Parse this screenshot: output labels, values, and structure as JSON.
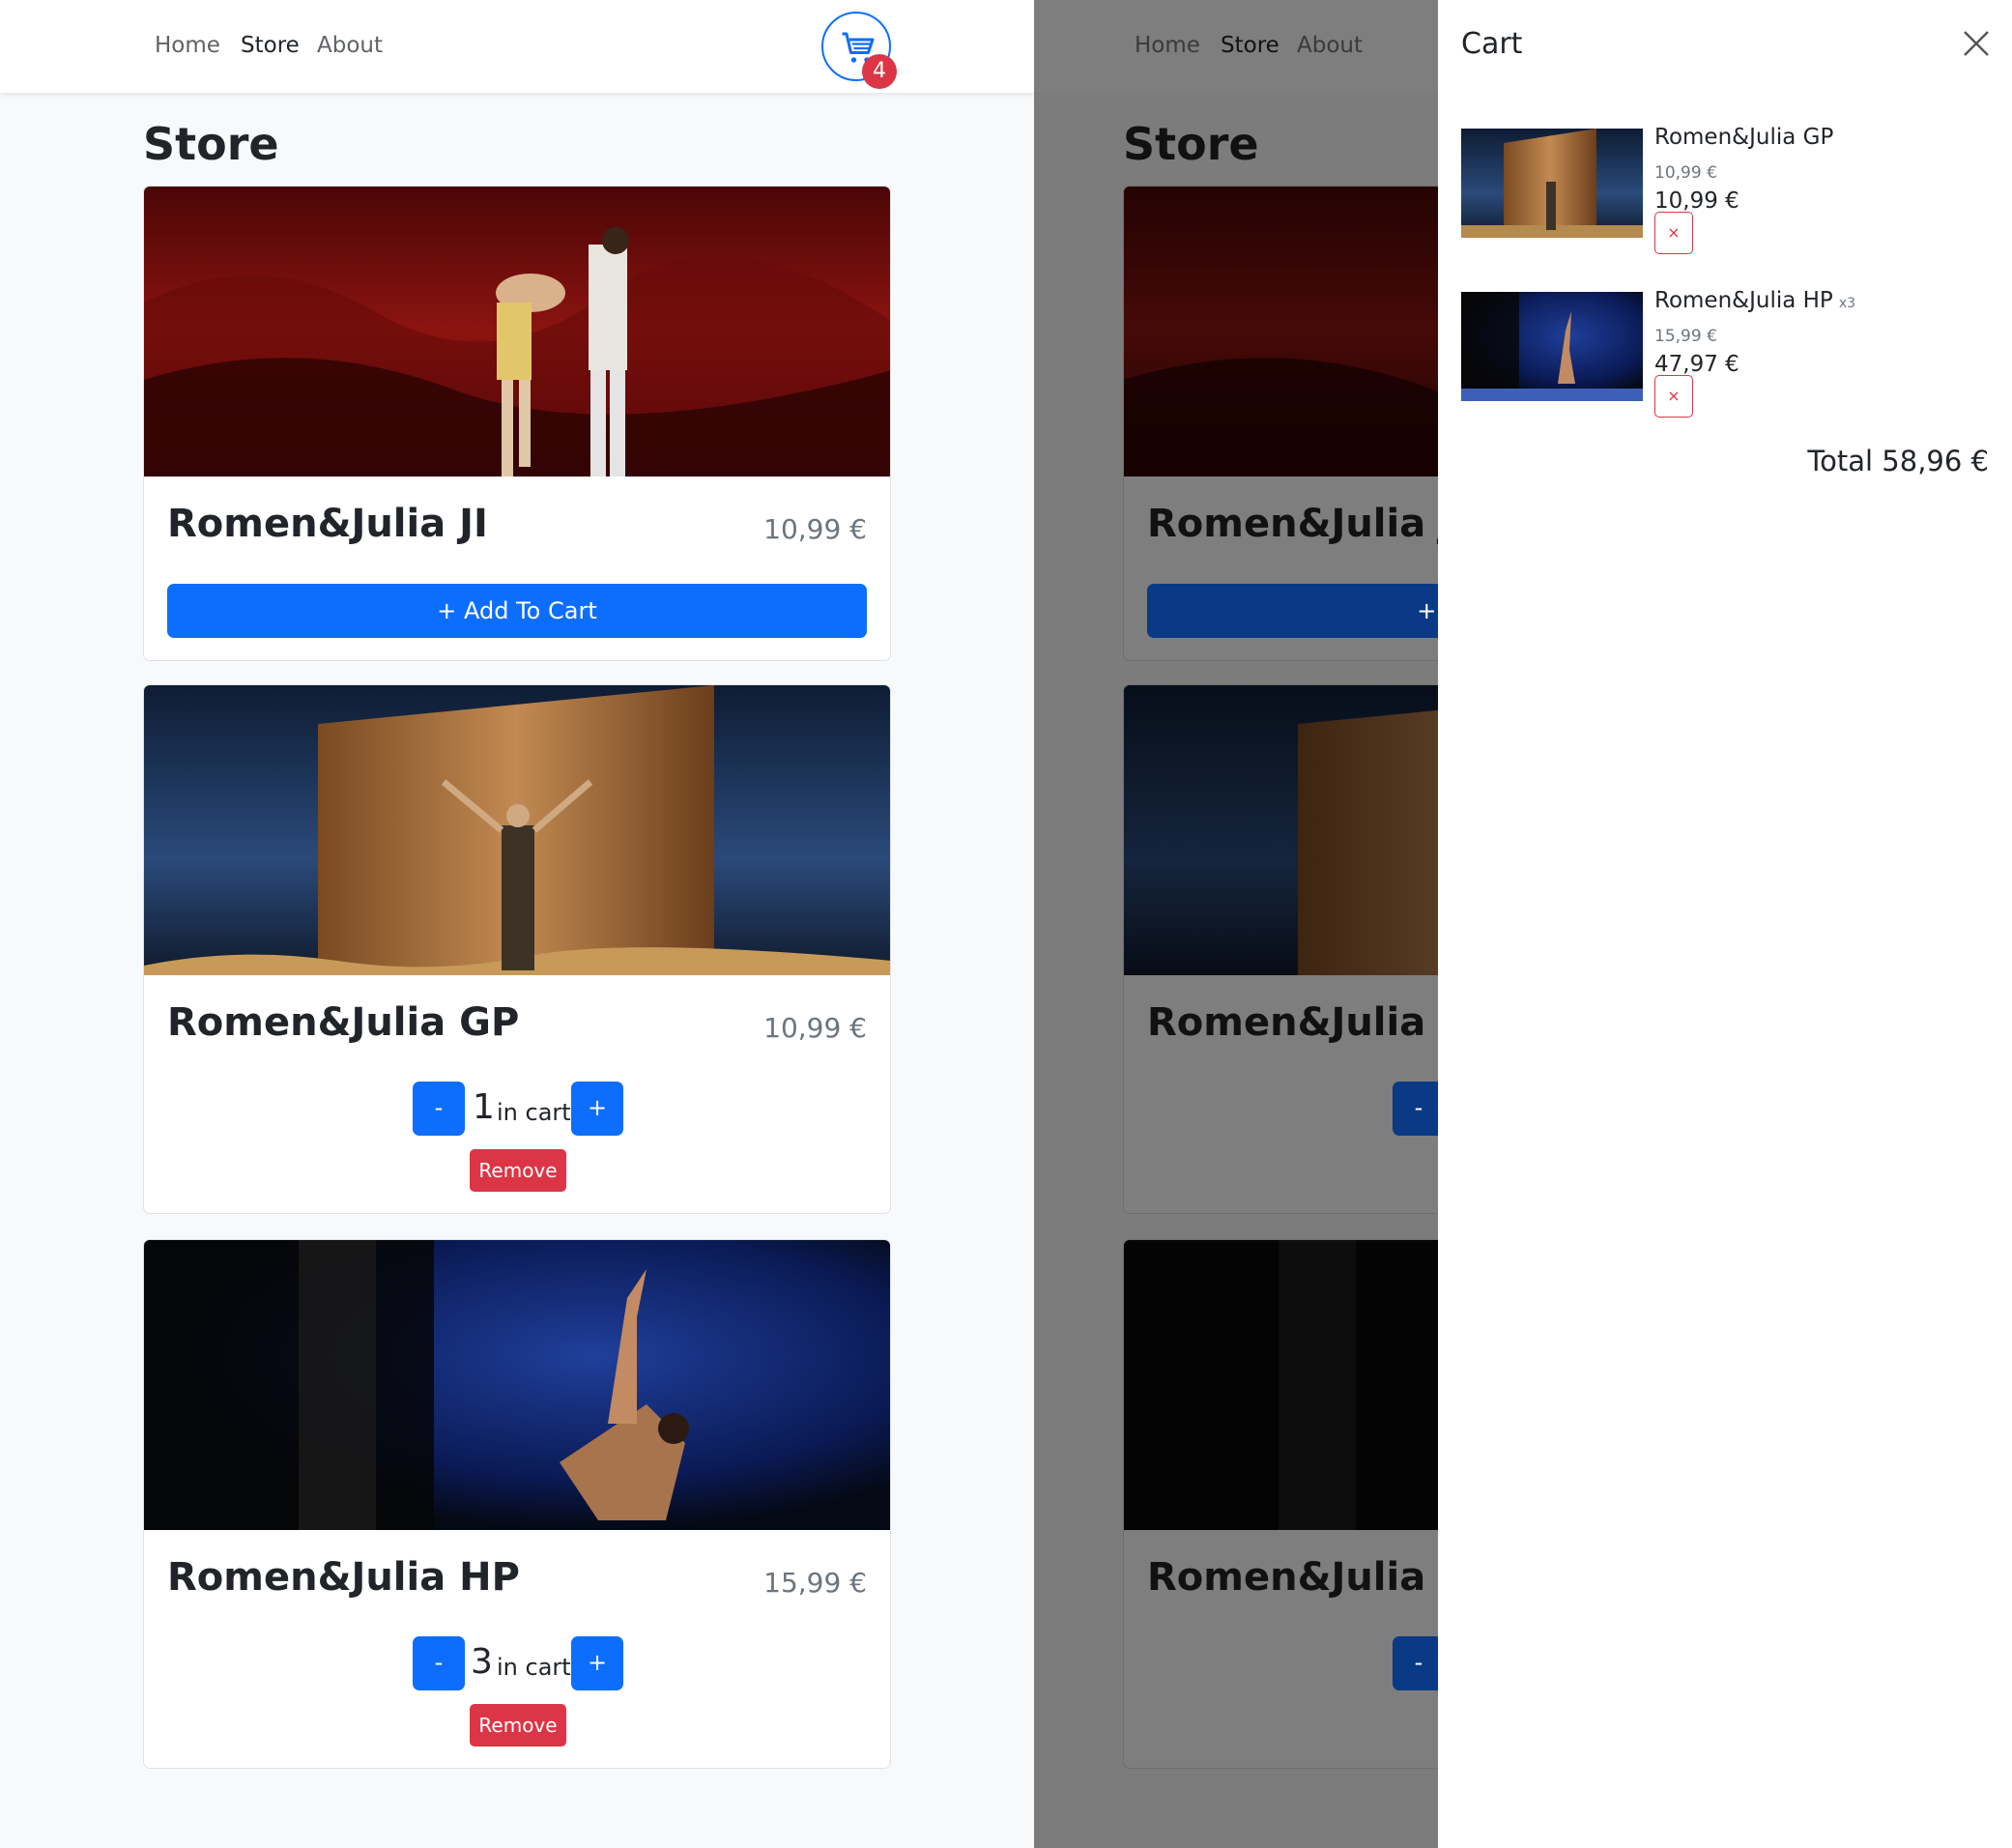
{
  "nav": {
    "links": [
      "Home",
      "Store",
      "About"
    ],
    "active": "Store",
    "cart_count": "4"
  },
  "store": {
    "title": "Store",
    "items": [
      {
        "name": "Romen&Julia JI",
        "price": "10,99 €",
        "in_cart": 0,
        "add_label": "+ Add To Cart"
      },
      {
        "name": "Romen&Julia GP",
        "price": "10,99 €",
        "in_cart": "1",
        "qty_label": "in cart",
        "minus": "-",
        "plus": "+",
        "remove_label": "Remove"
      },
      {
        "name": "Romen&Julia HP",
        "price": "15,99 €",
        "in_cart": "3",
        "qty_label": "in cart",
        "minus": "-",
        "plus": "+",
        "remove_label": "Remove"
      }
    ]
  },
  "cart": {
    "title": "Cart",
    "items": [
      {
        "name": "Romen&Julia GP",
        "qty": "",
        "unit_price": "10,99 €",
        "total": "10,99 €",
        "remove": "×"
      },
      {
        "name": "Romen&Julia HP",
        "qty": "x3",
        "unit_price": "15,99 €",
        "total": "47,97 €",
        "remove": "×"
      }
    ],
    "total": "Total 58,96 €"
  },
  "colors": {
    "primary": "#0d6efd",
    "danger": "#dc3545",
    "backdrop": "#808080"
  },
  "icons": [
    "cart-icon",
    "close-icon"
  ]
}
